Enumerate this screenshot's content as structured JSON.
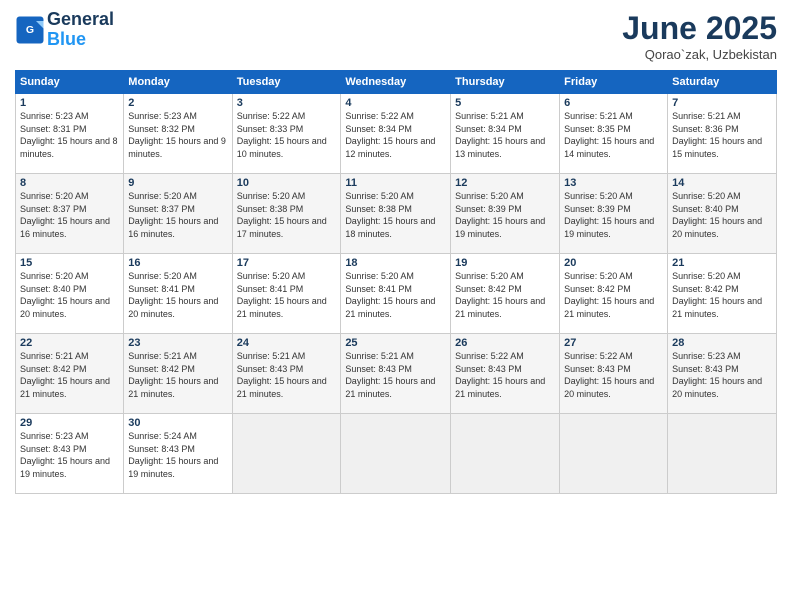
{
  "logo": {
    "line1": "General",
    "line2": "Blue"
  },
  "title": "June 2025",
  "subtitle": "Qorao`zak, Uzbekistan",
  "headers": [
    "Sunday",
    "Monday",
    "Tuesday",
    "Wednesday",
    "Thursday",
    "Friday",
    "Saturday"
  ],
  "weeks": [
    [
      {
        "day": "1",
        "sunrise": "5:23 AM",
        "sunset": "8:31 PM",
        "daylight": "15 hours and 8 minutes."
      },
      {
        "day": "2",
        "sunrise": "5:23 AM",
        "sunset": "8:32 PM",
        "daylight": "15 hours and 9 minutes."
      },
      {
        "day": "3",
        "sunrise": "5:22 AM",
        "sunset": "8:33 PM",
        "daylight": "15 hours and 10 minutes."
      },
      {
        "day": "4",
        "sunrise": "5:22 AM",
        "sunset": "8:34 PM",
        "daylight": "15 hours and 12 minutes."
      },
      {
        "day": "5",
        "sunrise": "5:21 AM",
        "sunset": "8:34 PM",
        "daylight": "15 hours and 13 minutes."
      },
      {
        "day": "6",
        "sunrise": "5:21 AM",
        "sunset": "8:35 PM",
        "daylight": "15 hours and 14 minutes."
      },
      {
        "day": "7",
        "sunrise": "5:21 AM",
        "sunset": "8:36 PM",
        "daylight": "15 hours and 15 minutes."
      }
    ],
    [
      {
        "day": "8",
        "sunrise": "5:20 AM",
        "sunset": "8:37 PM",
        "daylight": "15 hours and 16 minutes."
      },
      {
        "day": "9",
        "sunrise": "5:20 AM",
        "sunset": "8:37 PM",
        "daylight": "15 hours and 16 minutes."
      },
      {
        "day": "10",
        "sunrise": "5:20 AM",
        "sunset": "8:38 PM",
        "daylight": "15 hours and 17 minutes."
      },
      {
        "day": "11",
        "sunrise": "5:20 AM",
        "sunset": "8:38 PM",
        "daylight": "15 hours and 18 minutes."
      },
      {
        "day": "12",
        "sunrise": "5:20 AM",
        "sunset": "8:39 PM",
        "daylight": "15 hours and 19 minutes."
      },
      {
        "day": "13",
        "sunrise": "5:20 AM",
        "sunset": "8:39 PM",
        "daylight": "15 hours and 19 minutes."
      },
      {
        "day": "14",
        "sunrise": "5:20 AM",
        "sunset": "8:40 PM",
        "daylight": "15 hours and 20 minutes."
      }
    ],
    [
      {
        "day": "15",
        "sunrise": "5:20 AM",
        "sunset": "8:40 PM",
        "daylight": "15 hours and 20 minutes."
      },
      {
        "day": "16",
        "sunrise": "5:20 AM",
        "sunset": "8:41 PM",
        "daylight": "15 hours and 20 minutes."
      },
      {
        "day": "17",
        "sunrise": "5:20 AM",
        "sunset": "8:41 PM",
        "daylight": "15 hours and 21 minutes."
      },
      {
        "day": "18",
        "sunrise": "5:20 AM",
        "sunset": "8:41 PM",
        "daylight": "15 hours and 21 minutes."
      },
      {
        "day": "19",
        "sunrise": "5:20 AM",
        "sunset": "8:42 PM",
        "daylight": "15 hours and 21 minutes."
      },
      {
        "day": "20",
        "sunrise": "5:20 AM",
        "sunset": "8:42 PM",
        "daylight": "15 hours and 21 minutes."
      },
      {
        "day": "21",
        "sunrise": "5:20 AM",
        "sunset": "8:42 PM",
        "daylight": "15 hours and 21 minutes."
      }
    ],
    [
      {
        "day": "22",
        "sunrise": "5:21 AM",
        "sunset": "8:42 PM",
        "daylight": "15 hours and 21 minutes."
      },
      {
        "day": "23",
        "sunrise": "5:21 AM",
        "sunset": "8:42 PM",
        "daylight": "15 hours and 21 minutes."
      },
      {
        "day": "24",
        "sunrise": "5:21 AM",
        "sunset": "8:43 PM",
        "daylight": "15 hours and 21 minutes."
      },
      {
        "day": "25",
        "sunrise": "5:21 AM",
        "sunset": "8:43 PM",
        "daylight": "15 hours and 21 minutes."
      },
      {
        "day": "26",
        "sunrise": "5:22 AM",
        "sunset": "8:43 PM",
        "daylight": "15 hours and 21 minutes."
      },
      {
        "day": "27",
        "sunrise": "5:22 AM",
        "sunset": "8:43 PM",
        "daylight": "15 hours and 20 minutes."
      },
      {
        "day": "28",
        "sunrise": "5:23 AM",
        "sunset": "8:43 PM",
        "daylight": "15 hours and 20 minutes."
      }
    ],
    [
      {
        "day": "29",
        "sunrise": "5:23 AM",
        "sunset": "8:43 PM",
        "daylight": "15 hours and 19 minutes."
      },
      {
        "day": "30",
        "sunrise": "5:24 AM",
        "sunset": "8:43 PM",
        "daylight": "15 hours and 19 minutes."
      },
      null,
      null,
      null,
      null,
      null
    ]
  ]
}
